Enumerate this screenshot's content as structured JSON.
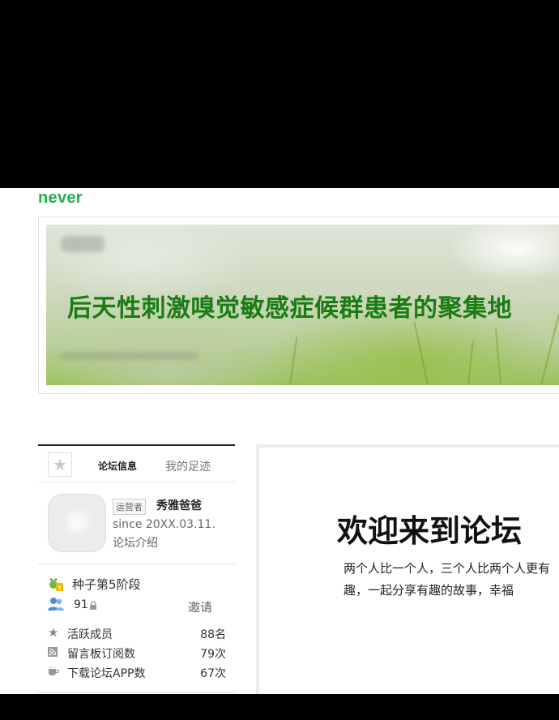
{
  "header": {
    "logo_text": "never"
  },
  "banner": {
    "title": "后天性刺激嗅觉敏感症候群患者的聚集地"
  },
  "sidebar": {
    "tabs": [
      {
        "label": "论坛信息"
      },
      {
        "label": "我的足迹"
      }
    ],
    "profile": {
      "role_badge": "运营者",
      "username": "秀雅爸爸",
      "since": "since 20XX.03.11.",
      "intro_link": "论坛介绍"
    },
    "stage": "种子第5阶段",
    "members": {
      "count": "91",
      "invite_label": "邀请"
    },
    "stats": [
      {
        "icon": "star-icon",
        "label": "活跃成员",
        "value": "88名"
      },
      {
        "icon": "rss-icon",
        "label": "留言板订阅数",
        "value": "79次"
      },
      {
        "icon": "cup-icon",
        "label": "下载论坛APP数",
        "value": "67次"
      }
    ]
  },
  "main": {
    "welcome_title": "欢迎来到论坛",
    "description": "两个人比一个人，三个人比两个人更有趣，一起分享有趣的故事，幸福"
  },
  "colors": {
    "brand": "#22b14c",
    "banner_title": "#1a7c14"
  }
}
